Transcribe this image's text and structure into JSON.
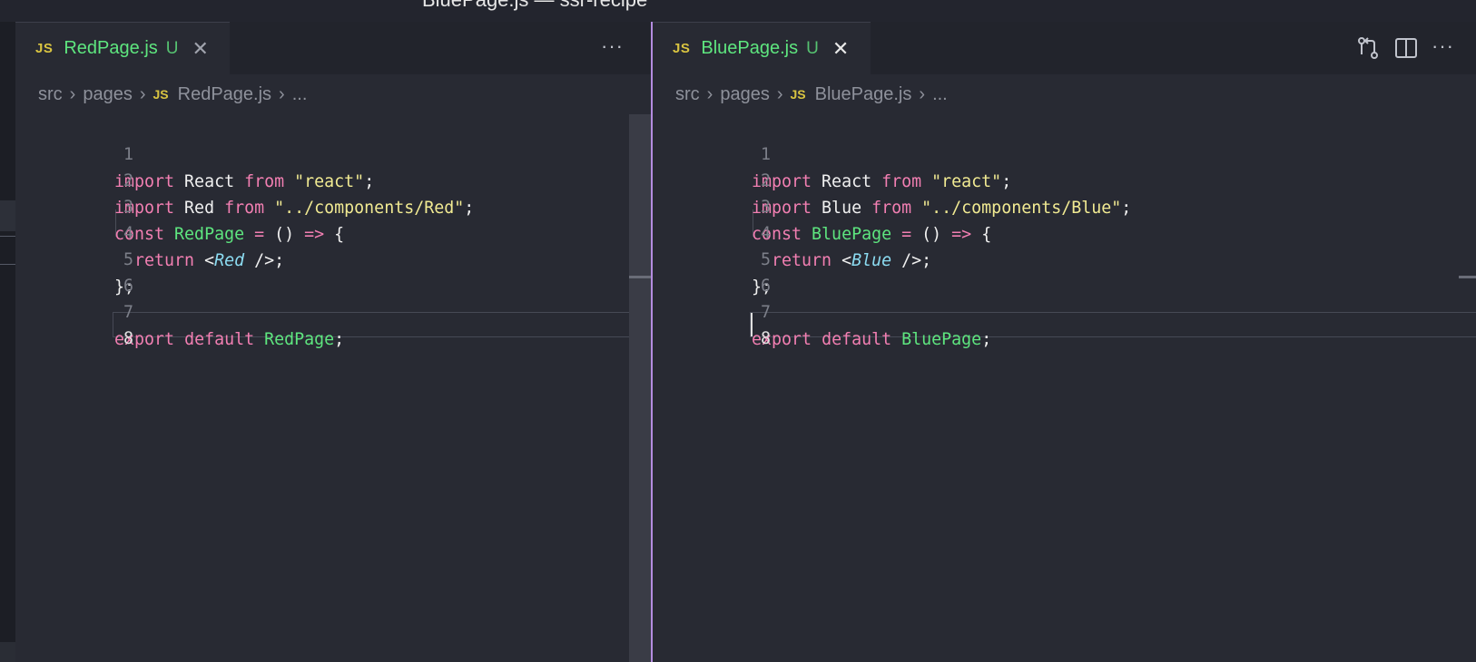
{
  "window": {
    "title": "BluePage.js — ssr-recipe"
  },
  "colors": {
    "background": "#282a33",
    "keyword": "#f27fb2",
    "function": "#5ee67f",
    "string": "#f1ea92",
    "jsx_tag": "#8cdcf2",
    "active_group_border": "#b48ce0"
  },
  "left": {
    "tab": {
      "icon": "JS",
      "name": "RedPage.js",
      "status": "U",
      "close": "✕"
    },
    "more": "···",
    "breadcrumb": {
      "items": [
        "src",
        "pages",
        "RedPage.js",
        "..."
      ],
      "file_icon": "JS",
      "sep": "›"
    },
    "code": {
      "line_numbers": [
        "1",
        "2",
        "3",
        "4",
        "5",
        "6",
        "7",
        "8"
      ],
      "l1": {
        "k1": "import",
        "t1": " React ",
        "k2": "from",
        "t2": " ",
        "s": "\"react\"",
        "t3": ";"
      },
      "l2": {
        "k1": "import",
        "t1": " Red ",
        "k2": "from",
        "t2": " ",
        "s": "\"../components/Red\"",
        "t3": ";"
      },
      "l3": {
        "k1": "const",
        "t1": " ",
        "f": "RedPage",
        "t2": " ",
        "op": "=",
        "t3": " () ",
        "arrow": "=>",
        "t4": " {"
      },
      "l4": {
        "k1": "  return",
        "t1": " <",
        "tag": "Red",
        "t2": " />;"
      },
      "l5": {
        "t1": "};"
      },
      "l7": {
        "k1": "export",
        "t1": " ",
        "k2": "default",
        "t2": " ",
        "f": "RedPage",
        "t3": ";"
      }
    }
  },
  "right": {
    "tab": {
      "icon": "JS",
      "name": "BluePage.js",
      "status": "U",
      "close": "✕"
    },
    "more": "···",
    "breadcrumb": {
      "items": [
        "src",
        "pages",
        "BluePage.js",
        "..."
      ],
      "file_icon": "JS",
      "sep": "›"
    },
    "code": {
      "line_numbers": [
        "1",
        "2",
        "3",
        "4",
        "5",
        "6",
        "7",
        "8"
      ],
      "l1": {
        "k1": "import",
        "t1": " React ",
        "k2": "from",
        "t2": " ",
        "s": "\"react\"",
        "t3": ";"
      },
      "l2": {
        "k1": "import",
        "t1": " Blue ",
        "k2": "from",
        "t2": " ",
        "s": "\"../components/Blue\"",
        "t3": ";"
      },
      "l3": {
        "k1": "const",
        "t1": " ",
        "f": "BluePage",
        "t2": " ",
        "op": "=",
        "t3": " () ",
        "arrow": "=>",
        "t4": " {"
      },
      "l4": {
        "k1": "  return",
        "t1": " <",
        "tag": "Blue",
        "t2": " />;"
      },
      "l5": {
        "t1": "};"
      },
      "l7": {
        "k1": "export",
        "t1": " ",
        "k2": "default",
        "t2": " ",
        "f": "BluePage",
        "t3": ";"
      }
    }
  },
  "icons": {
    "compare": "git-compare-icon",
    "split": "split-editor-icon",
    "more": "more-actions-icon",
    "close": "close-icon"
  }
}
